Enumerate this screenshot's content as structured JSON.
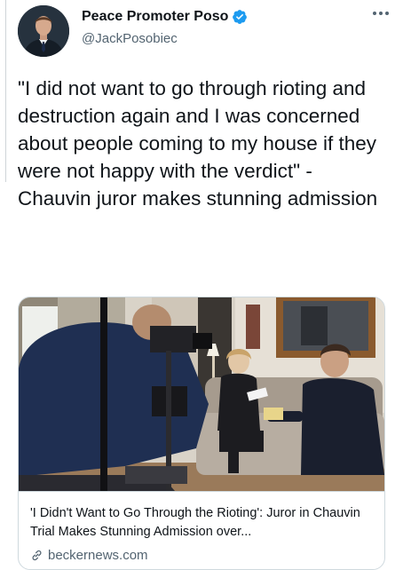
{
  "tweet": {
    "display_name": "Peace Promoter Poso",
    "handle": "@JackPosobiec",
    "text": "\"I did not want to go through rioting and destruction again and I was concerned about people coming to my house if they were not happy with the verdict\" - Chauvin juror makes stunning admission"
  },
  "link_card": {
    "title": "'I Didn't Want to Go Through the Rioting': Juror in Chauvin Trial Makes Stunning Admission over...",
    "domain": "beckernews.com"
  },
  "icons": {
    "verified": "verified-badge-icon",
    "more": "more-options-icon",
    "link": "link-icon"
  },
  "colors": {
    "verified_blue": "#1d9bf0",
    "secondary_text": "#536471",
    "border": "#cfd9de"
  }
}
